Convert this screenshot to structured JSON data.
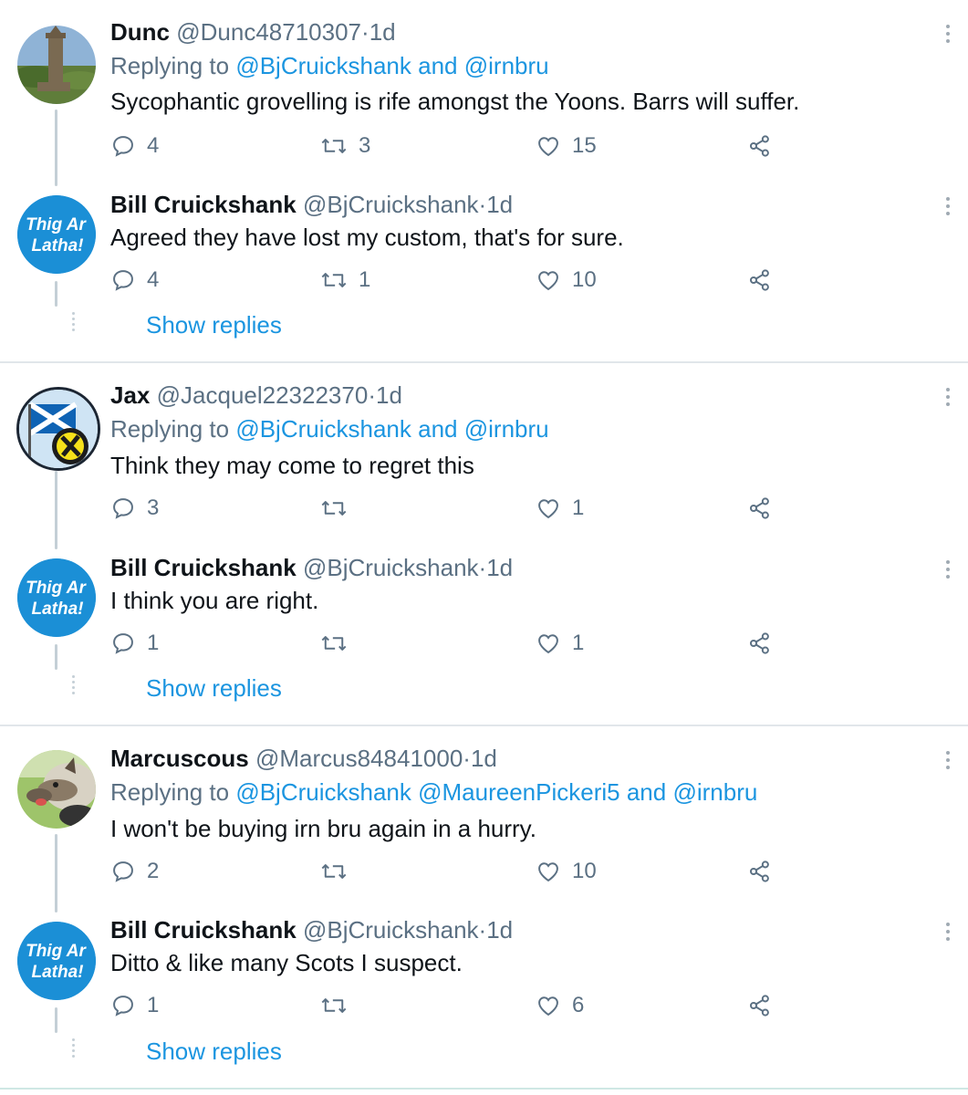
{
  "threads": [
    {
      "tweets": [
        {
          "name": "Dunc",
          "handle": "@Dunc48710307",
          "time": "1d",
          "avatar": "monument-photo",
          "replying_prefix": "Replying to",
          "replying_links": [
            "@BjCruickshank",
            "and",
            "@irnbru"
          ],
          "text": "Sycophantic grovelling is rife amongst the Yoons. Barrs will suffer.",
          "replies": "4",
          "retweets": "3",
          "likes": "15"
        },
        {
          "name": "Bill Cruickshank",
          "handle": "@BjCruickshank",
          "time": "1d",
          "avatar": "thig-ar-latha-badge",
          "avatar_text_1": "Thig Ar",
          "avatar_text_2": "Latha!",
          "text": "Agreed they have lost my custom, that's for sure.",
          "replies": "4",
          "retweets": "1",
          "likes": "10"
        }
      ],
      "show_replies": "Show replies"
    },
    {
      "tweets": [
        {
          "name": "Jax",
          "handle": "@Jacquel22322370",
          "time": "1d",
          "avatar": "saltire-snp-logo",
          "replying_prefix": "Replying to",
          "replying_links": [
            "@BjCruickshank",
            "and",
            "@irnbru"
          ],
          "text": "Think they may come to regret this",
          "replies": "3",
          "retweets": "",
          "likes": "1"
        },
        {
          "name": "Bill Cruickshank",
          "handle": "@BjCruickshank",
          "time": "1d",
          "avatar": "thig-ar-latha-badge",
          "avatar_text_1": "Thig Ar",
          "avatar_text_2": "Latha!",
          "text": "I think you are right.",
          "replies": "1",
          "retweets": "",
          "likes": "1"
        }
      ],
      "show_replies": "Show replies"
    },
    {
      "tweets": [
        {
          "name": "Marcuscous",
          "handle": "@Marcus84841000",
          "time": "1d",
          "avatar": "dog-photo",
          "replying_prefix": "Replying to",
          "replying_links": [
            "@BjCruickshank",
            "@MaureenPickeri5",
            "and",
            "@irnbru"
          ],
          "text": "I won't be buying irn bru again in a hurry.",
          "replies": "2",
          "retweets": "",
          "likes": "10"
        },
        {
          "name": "Bill Cruickshank",
          "handle": "@BjCruickshank",
          "time": "1d",
          "avatar": "thig-ar-latha-badge",
          "avatar_text_1": "Thig Ar",
          "avatar_text_2": "Latha!",
          "text": "Ditto & like many Scots I suspect.",
          "replies": "1",
          "retweets": "",
          "likes": "6"
        }
      ],
      "show_replies": "Show replies"
    }
  ],
  "separator_dot": "·",
  "colors": {
    "link": "#1b95e0",
    "muted": "#5b7083",
    "badge": "#1b8fd6",
    "divider": "#e1e6ea"
  },
  "icons": [
    "reply-icon",
    "retweet-icon",
    "like-icon",
    "share-icon",
    "more-options-icon"
  ]
}
